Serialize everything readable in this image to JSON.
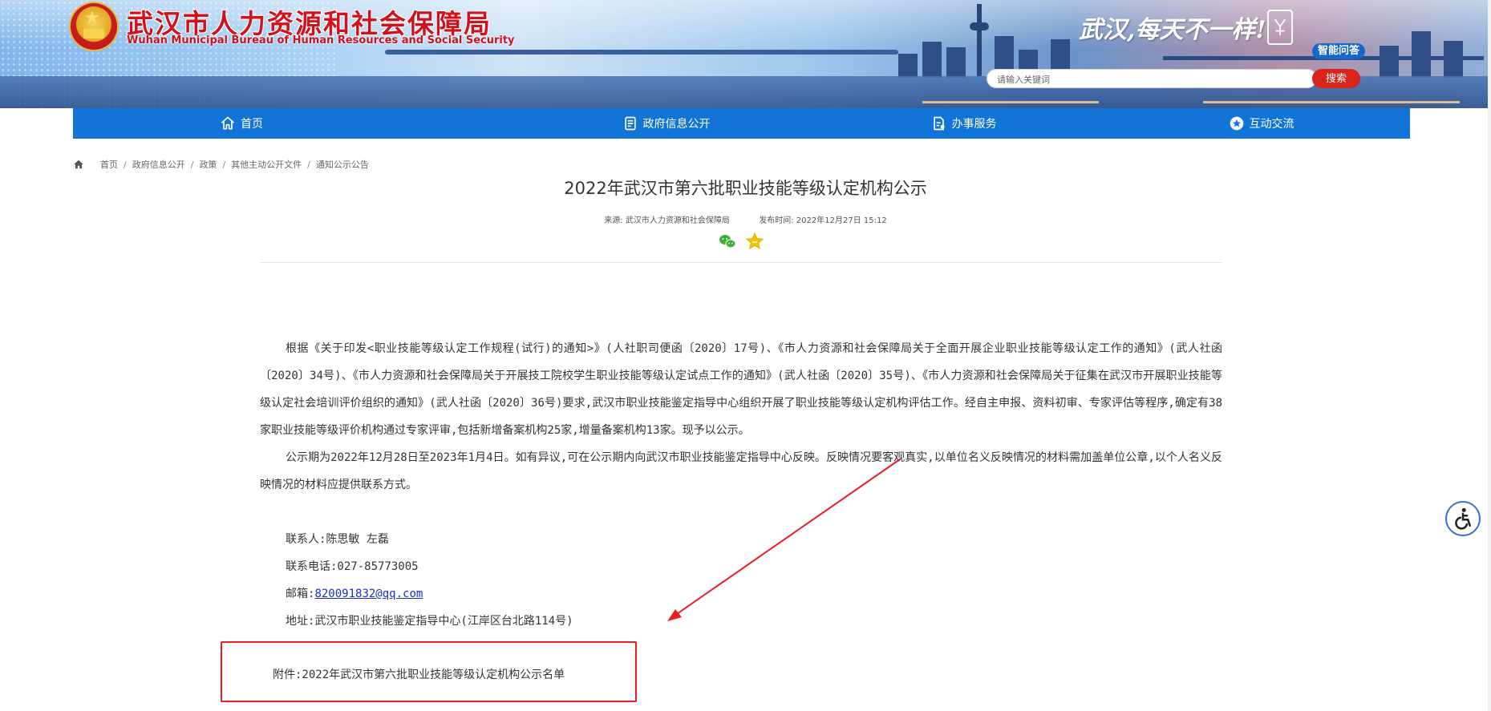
{
  "header": {
    "site_title": "武汉市人力资源和社会保障局",
    "site_subtitle": "Wuhan Municipal Bureau of Human Resources and Social Security",
    "slogan": "武汉,每天不一样!",
    "smart_qa_label": "智能问答",
    "search": {
      "placeholder": "请输入关键词",
      "value": "",
      "button_label": "搜索"
    }
  },
  "nav": {
    "items": [
      {
        "label": "首页",
        "icon": "home-icon"
      },
      {
        "label": "政府信息公开",
        "icon": "document-icon"
      },
      {
        "label": "办事服务",
        "icon": "service-icon"
      },
      {
        "label": "互动交流",
        "icon": "star-circle-icon"
      }
    ]
  },
  "breadcrumb": {
    "items": [
      "首页",
      "政府信息公开",
      "政策",
      "其他主动公开文件",
      "通知公示公告"
    ],
    "separator": "/"
  },
  "article": {
    "title": "2022年武汉市第六批职业技能等级认定机构公示",
    "source_label": "来源:",
    "source": "武汉市人力资源和社会保障局",
    "date_label": "发布时间:",
    "date": "2022年12月27日 15:12",
    "paragraphs": [
      "根据《关于印发<职业技能等级认定工作规程(试行)的通知>》(人社职司便函〔2020〕17号)、《市人力资源和社会保障局关于全面开展企业职业技能等级认定工作的通知》(武人社函〔2020〕34号)、《市人力资源和社会保障局关于开展技工院校学生职业技能等级认定试点工作的通知》(武人社函〔2020〕35号)、《市人力资源和社会保障局关于征集在武汉市开展职业技能等级认定社会培训评价组织的通知》(武人社函〔2020〕36号)要求,武汉市职业技能鉴定指导中心组织开展了职业技能等级认定机构评估工作。经自主申报、资料初审、专家评估等程序,确定有38家职业技能等级评价机构通过专家评审,包括新增备案机构25家,增量备案机构13家。现予以公示。",
      "公示期为2022年12月28日至2023年1月4日。如有异议,可在公示期内向武汉市职业技能鉴定指导中心反映。反映情况要客观真实,以单位名义反映情况的材料需加盖单位公章,以个人名义反映情况的材料应提供联系方式。"
    ],
    "contact": {
      "person": "联系人:陈思敏 左磊",
      "phone": "联系电话:027-85773005",
      "email_label": "邮箱:",
      "email": "820091832@qq.com",
      "address": "地址:武汉市职业技能鉴定指导中心(江岸区台北路114号)"
    },
    "attachment": "附件:2022年武汉市第六批职业技能等级认定机构公示名单"
  },
  "annotation": {
    "color": "#ea1c24"
  },
  "colors": {
    "nav_bg": "#1174d6",
    "title_red": "#d0121b",
    "search_button": "#d9241c"
  }
}
